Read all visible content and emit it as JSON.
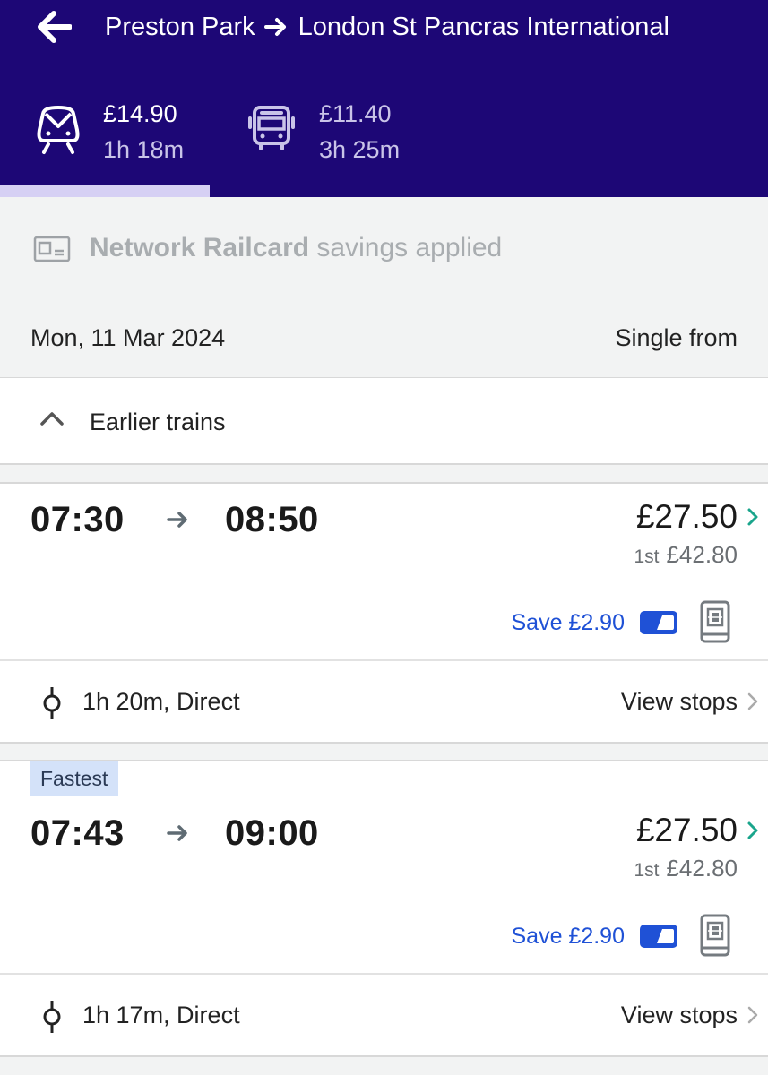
{
  "header": {
    "origin": "Preston Park",
    "destination": "London St Pancras International",
    "modes": [
      {
        "name": "train",
        "icon": "train-icon",
        "price": "£14.90",
        "duration": "1h 18m",
        "selected": true
      },
      {
        "name": "bus",
        "icon": "bus-icon",
        "price": "£11.40",
        "duration": "3h 25m",
        "selected": false
      }
    ]
  },
  "railcard": {
    "icon": "railcard-icon",
    "name": "Network Railcard",
    "suffix": " savings applied"
  },
  "date_row": {
    "date": "Mon, 11 Mar 2024",
    "fare_type": "Single from"
  },
  "earlier_trains": {
    "label": "Earlier trains"
  },
  "journeys": [
    {
      "badge": "",
      "depart": "07:30",
      "arrive": "08:50",
      "price": "£27.50",
      "first_label": "1st",
      "first_price": "£42.80",
      "save": "Save £2.90",
      "duration_info": "1h 20m, Direct",
      "view_stops": "View stops"
    },
    {
      "badge": "Fastest",
      "depart": "07:43",
      "arrive": "09:00",
      "price": "£27.50",
      "first_label": "1st",
      "first_price": "£42.80",
      "save": "Save £2.90",
      "duration_info": "1h 17m, Direct",
      "view_stops": "View stops"
    }
  ],
  "colors": {
    "header_bg": "#1d0776",
    "tab_underline": "#d6d0f4",
    "save_text": "#1f51d6",
    "badge_bg": "#d4e2f9",
    "chevron_accent": "#1aa58c"
  }
}
